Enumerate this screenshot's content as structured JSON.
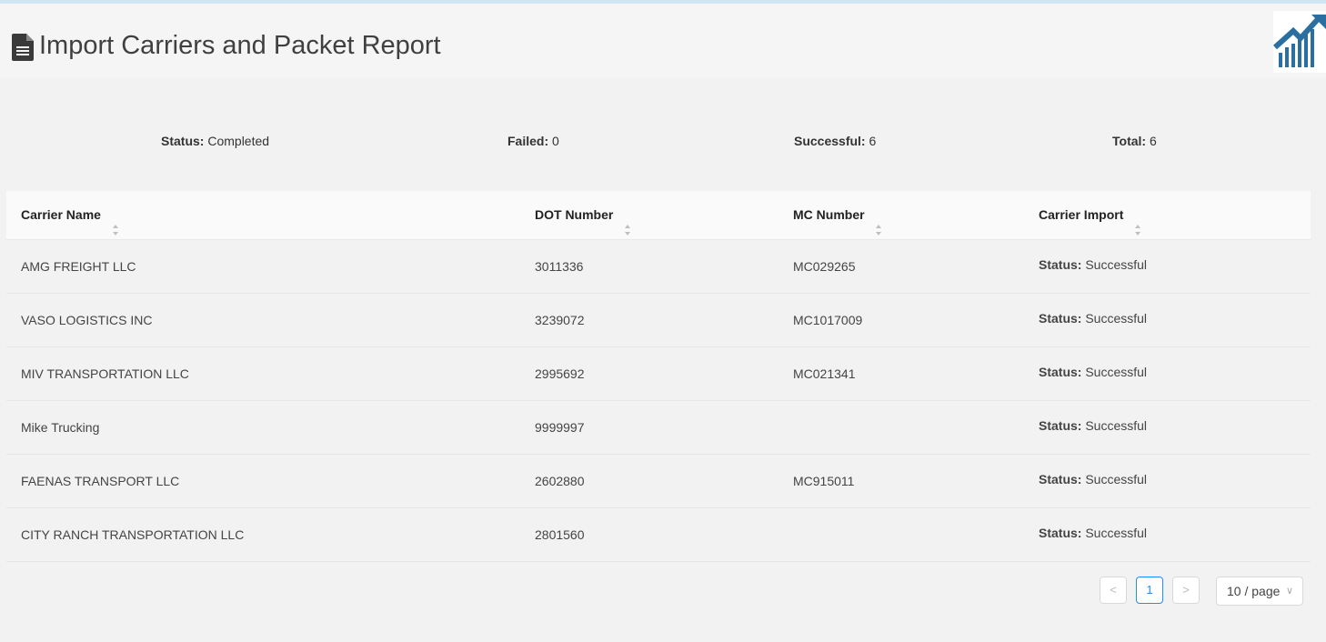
{
  "header": {
    "title": "Import Carriers and Packet Report"
  },
  "summary": {
    "status_label": "Status:",
    "status_value": "Completed",
    "failed_label": "Failed:",
    "failed_value": "0",
    "successful_label": "Successful:",
    "successful_value": "6",
    "total_label": "Total:",
    "total_value": "6"
  },
  "table": {
    "columns": [
      "Carrier Name",
      "DOT Number",
      "MC Number",
      "Carrier Import"
    ],
    "rows": [
      {
        "name": "AMG FREIGHT LLC",
        "dot": "3011336",
        "mc": "MC029265",
        "status_label": "Status:",
        "status": "Successful"
      },
      {
        "name": "VASO LOGISTICS INC",
        "dot": "3239072",
        "mc": "MC1017009",
        "status_label": "Status:",
        "status": "Successful"
      },
      {
        "name": "MIV TRANSPORTATION LLC",
        "dot": "2995692",
        "mc": "MC021341",
        "status_label": "Status:",
        "status": "Successful"
      },
      {
        "name": "Mike Trucking",
        "dot": "9999997",
        "mc": "",
        "status_label": "Status:",
        "status": "Successful"
      },
      {
        "name": "FAENAS TRANSPORT LLC",
        "dot": "2602880",
        "mc": "MC915011",
        "status_label": "Status:",
        "status": "Successful"
      },
      {
        "name": "CITY RANCH TRANSPORTATION LLC",
        "dot": "2801560",
        "mc": "",
        "status_label": "Status:",
        "status": "Successful"
      }
    ]
  },
  "pagination": {
    "prev": "<",
    "current_page": "1",
    "next": ">",
    "page_size": "10 / page",
    "page_size_icon": "chevron-down-icon"
  },
  "icons": {
    "title_icon": "document-icon",
    "logo": "chart-growth-logo"
  },
  "colors": {
    "accent": "#1890ff",
    "logo_blue": "#2a6fa0"
  }
}
